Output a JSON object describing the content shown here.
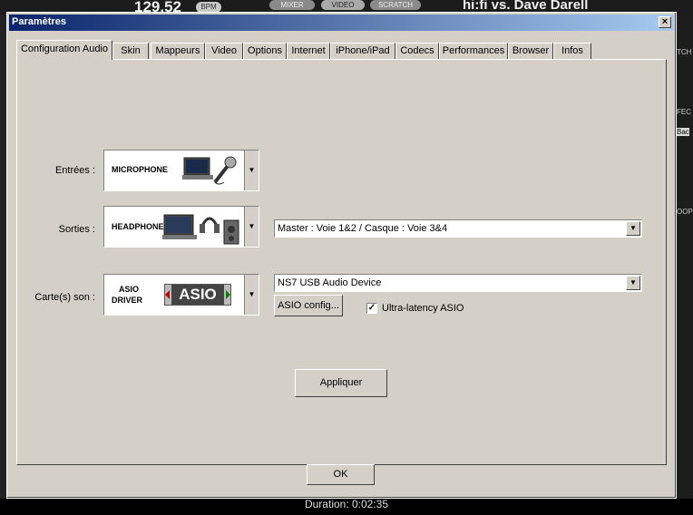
{
  "background": {
    "bpm_value": "129.52",
    "bpm_unit": "BPM",
    "mode_buttons": [
      "MIXER",
      "VIDEO",
      "SCRATCH"
    ],
    "track_title": "hi:fi vs. Dave Darell",
    "side_labels": [
      "TCH",
      "FEC",
      "Bac",
      "OOP"
    ],
    "duration": "Duration: 0:02:35"
  },
  "dialog": {
    "title": "Paramètres",
    "close_label": "×"
  },
  "tabs": [
    {
      "label": "Configuration Audio",
      "active": true
    },
    {
      "label": "Skin"
    },
    {
      "label": "Mappeurs"
    },
    {
      "label": "Video"
    },
    {
      "label": "Options"
    },
    {
      "label": "Internet"
    },
    {
      "label": "iPhone/iPad"
    },
    {
      "label": "Codecs"
    },
    {
      "label": "Performances"
    },
    {
      "label": "Browser"
    },
    {
      "label": "Infos"
    }
  ],
  "audio": {
    "inputs_label": "Entrées :",
    "inputs_value": "MICROPHONE",
    "outputs_label": "Sorties :",
    "outputs_value": "HEADPHONES",
    "outputs_routing": "Master : Voie 1&2 / Casque : Voie 3&4",
    "soundcard_label": "Carte(s) son :",
    "soundcard_type_line1": "ASIO",
    "soundcard_type_line2": "DRIVER",
    "soundcard_logo": "ASIO",
    "soundcard_device": "NS7 USB Audio Device",
    "asio_config_label": "ASIO config...",
    "ultra_latency_label": "Ultra-latency ASIO",
    "ultra_latency_checked": true,
    "apply_label": "Appliquer"
  },
  "ok_label": "OK"
}
